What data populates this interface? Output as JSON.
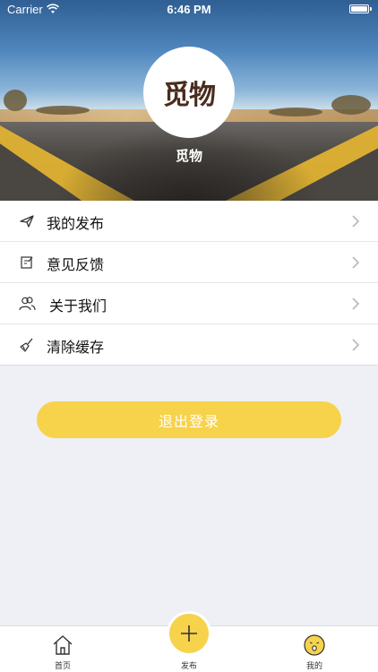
{
  "status_bar": {
    "carrier": "Carrier",
    "time": "6:46 PM"
  },
  "profile": {
    "logo_text": "觅物",
    "username": "觅物"
  },
  "menu": {
    "items": [
      {
        "label": "我的发布",
        "icon": "paper-plane-icon"
      },
      {
        "label": "意见反馈",
        "icon": "feedback-note-icon"
      },
      {
        "label": "关于我们",
        "icon": "people-icon"
      },
      {
        "label": "清除缓存",
        "icon": "broom-icon"
      }
    ]
  },
  "logout": {
    "label": "退出登录"
  },
  "tab_bar": {
    "home_label": "首页",
    "publish_label": "发布",
    "mine_label": "我的"
  },
  "colors": {
    "accent": "#f7d24b",
    "background": "#eff0f5",
    "logo_brown": "#4a2c1d"
  }
}
